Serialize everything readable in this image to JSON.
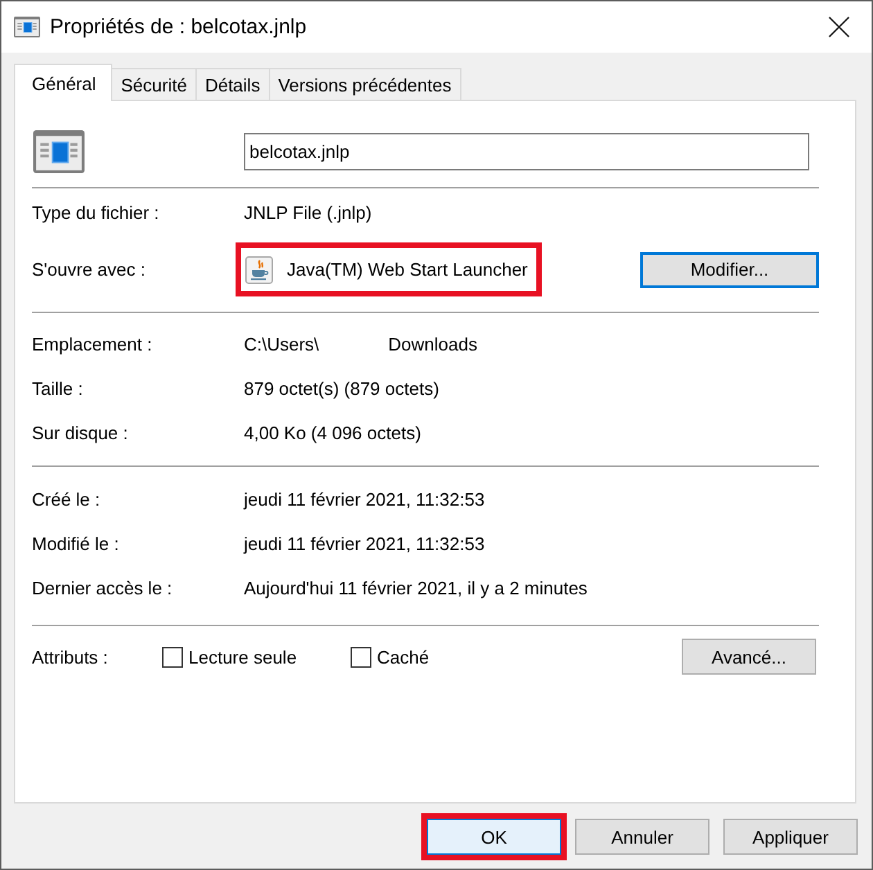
{
  "window": {
    "title": "Propriétés de : belcotax.jnlp"
  },
  "tabs": [
    {
      "label": "Général",
      "selected": true
    },
    {
      "label": "Sécurité",
      "selected": false
    },
    {
      "label": "Détails",
      "selected": false
    },
    {
      "label": "Versions précédentes",
      "selected": false
    }
  ],
  "file_name": "belcotax.jnlp",
  "sections": [
    {
      "rows": [
        {
          "kind": "text",
          "label": "Type du fichier :",
          "value": "JNLP File (.jnlp)"
        },
        {
          "kind": "app",
          "label": "S'ouvre avec :",
          "value": "Java(TM) Web Start Launcher",
          "highlighted": true,
          "button": {
            "label": "Modifier...",
            "focused": true
          }
        }
      ]
    },
    {
      "rows": [
        {
          "kind": "redacted",
          "label": "Emplacement :",
          "value_start": "C:\\Users\\",
          "value_end": "Downloads"
        },
        {
          "kind": "text",
          "label": "Taille :",
          "value": "879 octet(s) (879 octets)"
        },
        {
          "kind": "text",
          "label": "Sur disque :",
          "value": "4,00 Ko (4 096 octets)"
        }
      ]
    },
    {
      "rows": [
        {
          "kind": "text",
          "label": "Créé le :",
          "value": "jeudi 11 février 2021, 11:32:53"
        },
        {
          "kind": "text",
          "label": "Modifié le :",
          "value": "jeudi 11 février 2021, 11:32:53"
        },
        {
          "kind": "text",
          "label": "Dernier accès le :",
          "value": "Aujourd'hui 11 février 2021, il y a 2 minutes"
        }
      ]
    },
    {
      "rows": [
        {
          "kind": "attributes",
          "label": "Attributs :",
          "checkboxes": [
            {
              "label": "Lecture seule",
              "checked": false
            },
            {
              "label": "Caché",
              "checked": false
            }
          ],
          "button": {
            "label": "Avancé...",
            "focused": false
          }
        }
      ]
    }
  ],
  "buttons": [
    {
      "label": "OK",
      "default": true,
      "highlighted": true
    },
    {
      "label": "Annuler",
      "default": false,
      "highlighted": false
    },
    {
      "label": "Appliquer",
      "default": false,
      "highlighted": false
    }
  ]
}
